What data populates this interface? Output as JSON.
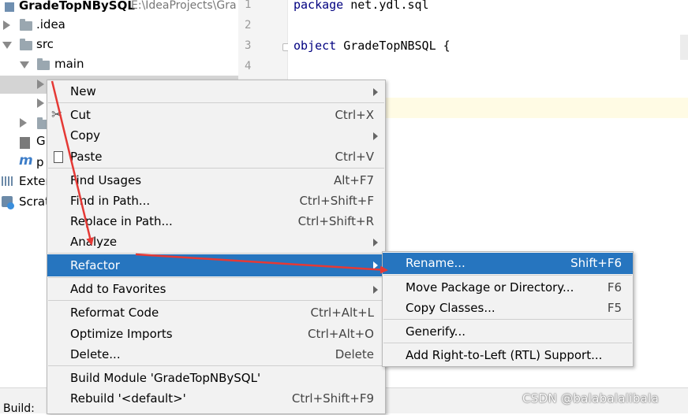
{
  "project_tree": {
    "root_name": "GradeTopNBySQL",
    "root_path": "E:\\IdeaProjects\\Gra",
    "items": [
      {
        "label": ".idea"
      },
      {
        "label": "src"
      },
      {
        "label": "main"
      },
      {
        "label": "Exter"
      },
      {
        "label": "Scrat"
      }
    ],
    "partial_labels": [
      "G",
      "p"
    ]
  },
  "editor": {
    "line_numbers": [
      "1",
      "2",
      "3",
      "4"
    ],
    "line1_keyword": "package",
    "line1_rest": " net.ydl.sql",
    "line3_keyword": "object",
    "line3_rest": " GradeTopNBSQL {"
  },
  "context_menu": {
    "items": [
      {
        "label": "New",
        "shortcut": "",
        "submenu": true
      },
      {
        "label": "Cut",
        "shortcut": "Ctrl+X"
      },
      {
        "label": "Copy",
        "shortcut": "",
        "submenu": true
      },
      {
        "label": "Paste",
        "shortcut": "Ctrl+V"
      },
      {
        "label": "Find Usages",
        "shortcut": "Alt+F7"
      },
      {
        "label": "Find in Path...",
        "shortcut": "Ctrl+Shift+F"
      },
      {
        "label": "Replace in Path...",
        "shortcut": "Ctrl+Shift+R"
      },
      {
        "label": "Analyze",
        "shortcut": "",
        "submenu": true
      },
      {
        "label": "Refactor",
        "shortcut": "",
        "submenu": true
      },
      {
        "label": "Add to Favorites",
        "shortcut": "",
        "submenu": true
      },
      {
        "label": "Reformat Code",
        "shortcut": "Ctrl+Alt+L"
      },
      {
        "label": "Optimize Imports",
        "shortcut": "Ctrl+Alt+O"
      },
      {
        "label": "Delete...",
        "shortcut": "Delete"
      },
      {
        "label": "Build Module 'GradeTopNBySQL'",
        "shortcut": ""
      },
      {
        "label": "Rebuild '<default>'",
        "shortcut": "Ctrl+Shift+F9"
      }
    ]
  },
  "refactor_submenu": {
    "items": [
      {
        "label": "Rename...",
        "shortcut": "Shift+F6"
      },
      {
        "label": "Move Package or Directory...",
        "shortcut": "F6"
      },
      {
        "label": "Copy Classes...",
        "shortcut": "F5"
      },
      {
        "label": "Generify...",
        "shortcut": ""
      },
      {
        "label": "Add Right-to-Left (RTL) Support...",
        "shortcut": ""
      }
    ]
  },
  "bottom": {
    "build_label": "Build:"
  },
  "watermark": "CSDN @balabalalibala",
  "colors": {
    "selection": "#2675bf",
    "annotation_arrow": "#e53935",
    "menu_bg": "#f2f2f2"
  },
  "icons": [
    "scissors-icon",
    "clipboard-icon",
    "folder-icon",
    "module-icon",
    "library-icon",
    "scratches-icon"
  ]
}
